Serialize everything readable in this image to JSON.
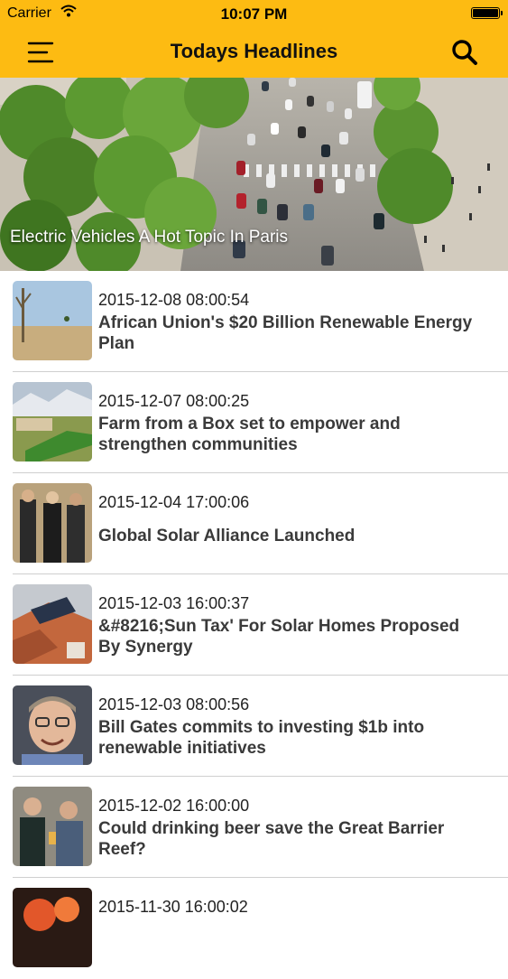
{
  "status_bar": {
    "carrier": "Carrier",
    "time": "10:07 PM"
  },
  "nav": {
    "title": "Todays Headlines",
    "menu_icon": "hamburger-menu-icon",
    "search_icon": "search-icon"
  },
  "hero": {
    "caption": "Electric Vehicles A Hot Topic In Paris"
  },
  "articles": [
    {
      "date": "2015-12-08 08:00:54",
      "headline": "African Union's $20 Billion Renewable Energy Plan"
    },
    {
      "date": "2015-12-07 08:00:25",
      "headline": "Farm from a Box set to empower and strengthen communities"
    },
    {
      "date": "2015-12-04 17:00:06",
      "headline": "Global Solar Alliance Launched"
    },
    {
      "date": "2015-12-03 16:00:37",
      "headline": "&#8216;Sun Tax' For Solar Homes Proposed By Synergy"
    },
    {
      "date": "2015-12-03 08:00:56",
      "headline": "Bill Gates commits to investing $1b into renewable initiatives"
    },
    {
      "date": "2015-12-02 16:00:00",
      "headline": "Could drinking beer save the Great Barrier Reef?"
    },
    {
      "date": "2015-11-30 16:00:02",
      "headline": ""
    }
  ],
  "colors": {
    "accent": "#FDBB12"
  }
}
